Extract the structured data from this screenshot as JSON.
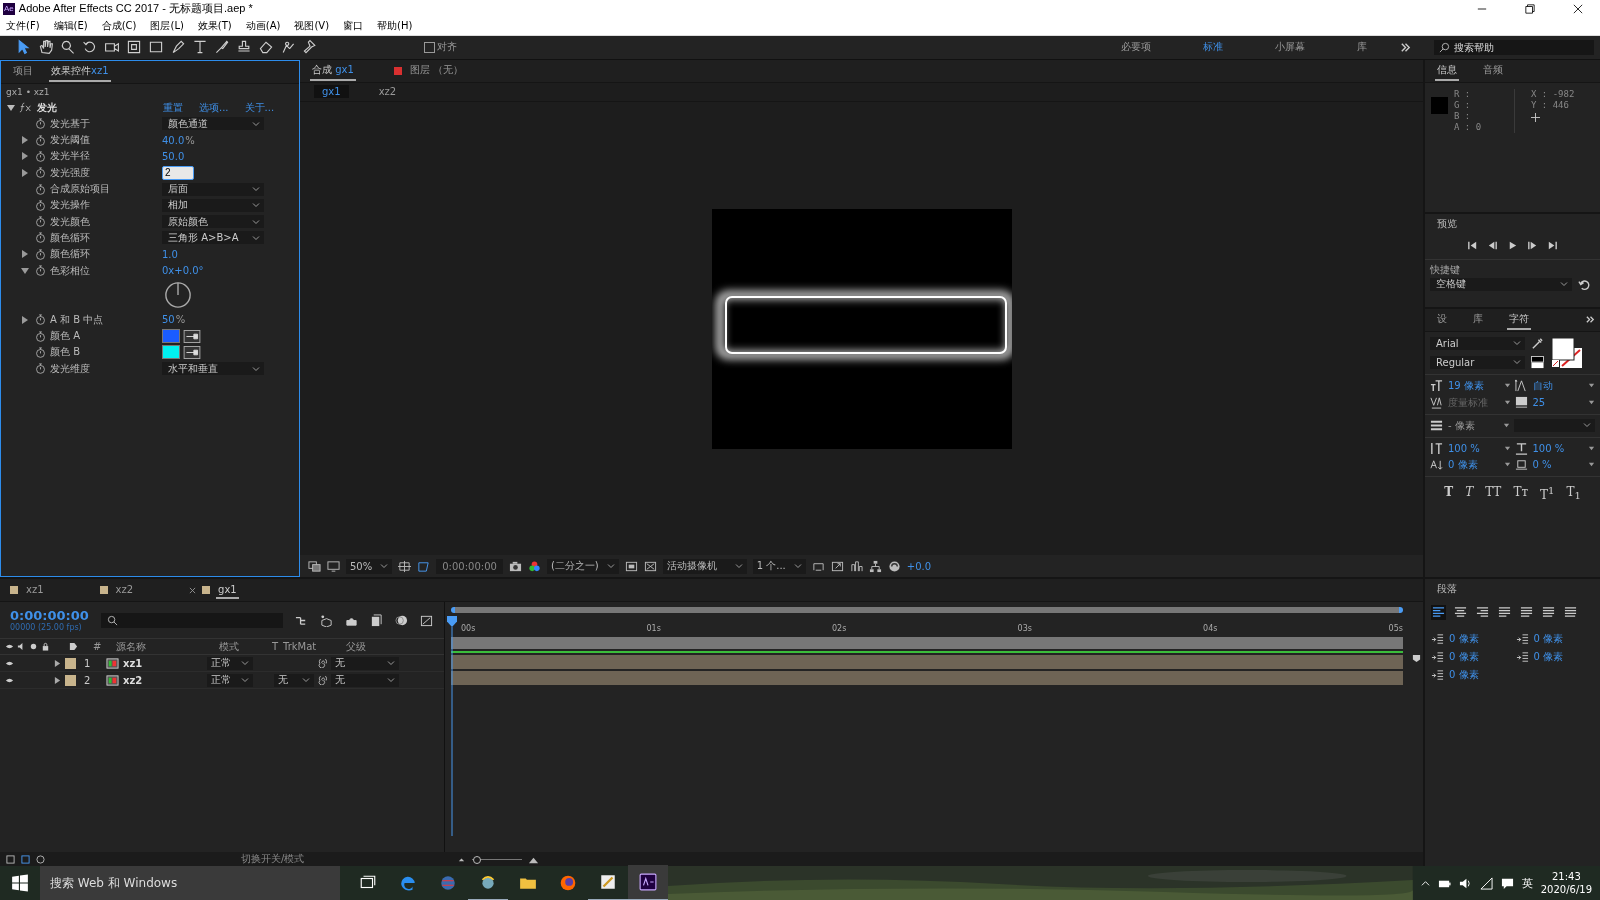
{
  "window": {
    "title": "Adobe After Effects CC 2017 - 无标题项目.aep *",
    "app_badge": "Ae"
  },
  "menu": [
    "文件(F)",
    "编辑(E)",
    "合成(C)",
    "图层(L)",
    "效果(T)",
    "动画(A)",
    "视图(V)",
    "窗口",
    "帮助(H)"
  ],
  "toolbar": {
    "tools": [
      {
        "selected": true
      },
      {
        "selected": false
      },
      {
        "selected": false
      },
      {
        "selected": false
      },
      {
        "selected": false
      },
      {
        "selected": false
      },
      {
        "selected": false
      },
      {
        "selected": false
      },
      {
        "selected": false
      },
      {
        "selected": false
      },
      {
        "selected": false
      },
      {
        "selected": false
      },
      {
        "selected": false
      },
      {
        "selected": false
      }
    ],
    "snapping": {
      "label": "对齐",
      "checked": false
    }
  },
  "workspaces": [
    {
      "label": "必要项",
      "selected": false
    },
    {
      "label": "标准",
      "selected": true
    },
    {
      "label": "小屏幕",
      "selected": false
    },
    {
      "label": "库",
      "selected": false
    }
  ],
  "help_search": {
    "placeholder": "搜索帮助"
  },
  "effect_panel": {
    "tabs": [
      {
        "label": "项目",
        "selected": false
      },
      {
        "label": "效果控件",
        "layer": "xz1",
        "selected": true
      }
    ],
    "breadcrumb": "gx1 • xz1",
    "effect": {
      "name": "发光",
      "expanded": true,
      "links": [
        "重置",
        "选项...",
        "关于..."
      ],
      "params": [
        {
          "kind": "dropdown",
          "name": "发光基于",
          "value": "颜色通道"
        },
        {
          "kind": "number",
          "name": "发光阈值",
          "value": "40.0",
          "unit": "%",
          "expanded": false
        },
        {
          "kind": "number",
          "name": "发光半径",
          "value": "50.0",
          "expanded": false
        },
        {
          "kind": "input",
          "name": "发光强度",
          "value": "2",
          "expanded": false
        },
        {
          "kind": "dropdown",
          "name": "合成原始项目",
          "value": "后面"
        },
        {
          "kind": "dropdown",
          "name": "发光操作",
          "value": "相加"
        },
        {
          "kind": "dropdown",
          "name": "发光颜色",
          "value": "原始颜色"
        },
        {
          "kind": "dropdown",
          "name": "颜色循环",
          "value": "三角形 A>B>A"
        },
        {
          "kind": "number",
          "name": "颜色循环",
          "value": "1.0",
          "expanded": false
        },
        {
          "kind": "angle",
          "name": "色彩相位",
          "value": "0x+0.0°",
          "expanded": true
        },
        {
          "kind": "number",
          "name": "A 和 B 中点",
          "value": "50",
          "unit": "%",
          "expanded": false
        },
        {
          "kind": "color",
          "name": "颜色 A",
          "color": "#1a5cff"
        },
        {
          "kind": "color",
          "name": "颜色 B",
          "color": "#00f0f0"
        },
        {
          "kind": "dropdown",
          "name": "发光维度",
          "value": "水平和垂直"
        }
      ]
    }
  },
  "comp_panel": {
    "tabs": [
      {
        "kind": "comp",
        "label": "合成",
        "comp": "gx1",
        "selected": true
      },
      {
        "kind": "layer",
        "label": "图层 （无）",
        "selected": false
      }
    ],
    "nav": [
      {
        "label": "gx1",
        "selected": true
      },
      {
        "label": "xz2",
        "selected": false
      }
    ],
    "viewer_bar": {
      "zoom": "50%",
      "timecode": "0:00:00:00",
      "resolution": "(二分之一)",
      "camera": "活动摄像机",
      "views": "1 个...",
      "exposure": "+0.0"
    }
  },
  "info_panel": {
    "tabs": [
      {
        "label": "信息",
        "selected": true
      },
      {
        "label": "音频",
        "selected": false
      }
    ],
    "channels": [
      "R :",
      "G :",
      "B :",
      "A : 0"
    ],
    "coords": [
      "X : -982",
      "Y : 446"
    ]
  },
  "preview_panel": {
    "title": "预览",
    "shortcut_label": "快捷键",
    "shortcut": "空格键"
  },
  "character_panel": {
    "tabs": [
      {
        "label": "设",
        "selected": false
      },
      {
        "label": "库",
        "selected": false
      },
      {
        "label": "字符",
        "selected": true
      }
    ],
    "font": "Arial",
    "style": "Regular",
    "size": "19 像素",
    "leading": "自动",
    "kerning": {
      "value": "度量标准",
      "disabled": true
    },
    "tracking": "25",
    "stroke": "- 像素",
    "vscale": "100 %",
    "hscale": "100 %",
    "baseline": "0 像素",
    "tsume": "0 %",
    "styles": [
      {
        "kind": "bold",
        "label": "T"
      },
      {
        "kind": "italic",
        "label": "T"
      },
      {
        "kind": "caps",
        "label": "TT"
      },
      {
        "kind": "smallcaps",
        "label": "Tт"
      },
      {
        "kind": "super",
        "label": "T$^{1}$"
      },
      {
        "kind": "sub",
        "label": "T$_{1}$"
      }
    ]
  },
  "paragraph_panel": {
    "title": "段落",
    "align": [
      {
        "selected": true
      },
      {
        "selected": false
      },
      {
        "selected": false
      },
      {
        "selected": false
      },
      {
        "selected": false
      },
      {
        "selected": false
      },
      {
        "selected": false
      }
    ],
    "indents": [
      "0 像素",
      "0 像素",
      "0 像素",
      "0 像素",
      "0 像素"
    ]
  },
  "timeline": {
    "tabs": [
      {
        "label": "xz1",
        "selected": false
      },
      {
        "label": "xz2",
        "selected": false
      },
      {
        "label": "gx1",
        "selected": true
      }
    ],
    "timecode": "0:00:00:00",
    "frame_info": "00000 (25.00 fps)",
    "columns": [
      "#",
      "源名称",
      "模式",
      "T",
      "TrkMat",
      "父级"
    ],
    "layers": [
      {
        "index": "1",
        "name": "xz1",
        "mode": "正常",
        "parent": "无",
        "visible": true,
        "color": "#c8b48c"
      },
      {
        "index": "2",
        "name": "xz2",
        "mode": "正常",
        "trkmat": "无",
        "parent": "无",
        "visible": true,
        "color": "#c8b48c"
      }
    ],
    "ruler": [
      "00s",
      "01s",
      "02s",
      "03s",
      "04s",
      "05s"
    ],
    "footer": "切换开关/模式",
    "zoom": {
      "level": 0.08
    }
  },
  "taskbar": {
    "search": "搜索 Web 和 Windows",
    "ime": "英",
    "time": "21:43",
    "date": "2020/6/19"
  }
}
